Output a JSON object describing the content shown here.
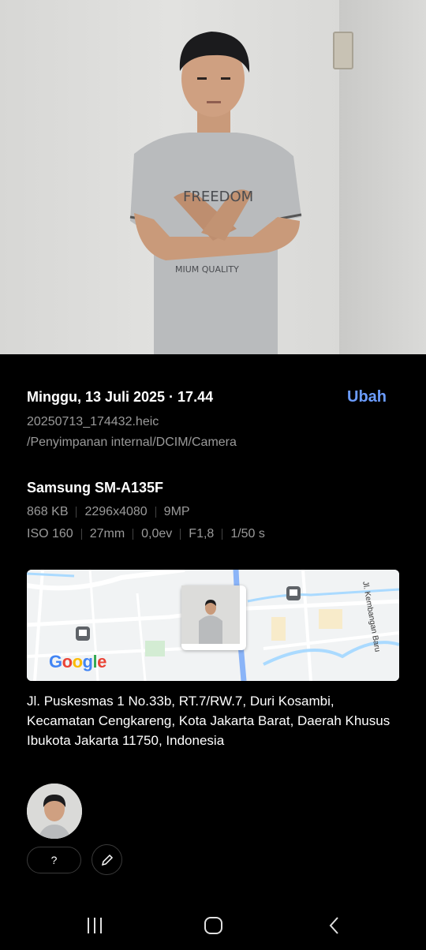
{
  "photo": {
    "description_icon": "person-photo"
  },
  "details": {
    "date_time": "Minggu, 13 Juli 2025 · 17.44",
    "edit_label": "Ubah",
    "filename": "20250713_174432.heic",
    "path": "/Penyimpanan internal/DCIM/Camera"
  },
  "device": {
    "name": "Samsung SM-A135F",
    "size": "868 KB",
    "resolution": "2296x4080",
    "megapixels": "9MP",
    "iso": "ISO 160",
    "focal": "27mm",
    "ev": "0,0ev",
    "aperture": "F1,8",
    "shutter": "1/50 s"
  },
  "map": {
    "logo": "Google",
    "street_label": "Jl. Kembangan Baru",
    "colors": {
      "road": "#ffffff",
      "water": "#aadaff",
      "highway": "#8ab4f8"
    }
  },
  "location": {
    "address": "Jl. Puskesmas 1 No.33b, RT.7/RW.7, Duri Kosambi, Kecamatan Cengkareng, Kota Jakarta Barat, Daerah Khusus Ibukota Jakarta 11750, Indonesia"
  },
  "people": {
    "tag_label": "?"
  },
  "nav": {
    "recents_icon": "recents-icon",
    "home_icon": "home-icon",
    "back_icon": "back-icon"
  }
}
